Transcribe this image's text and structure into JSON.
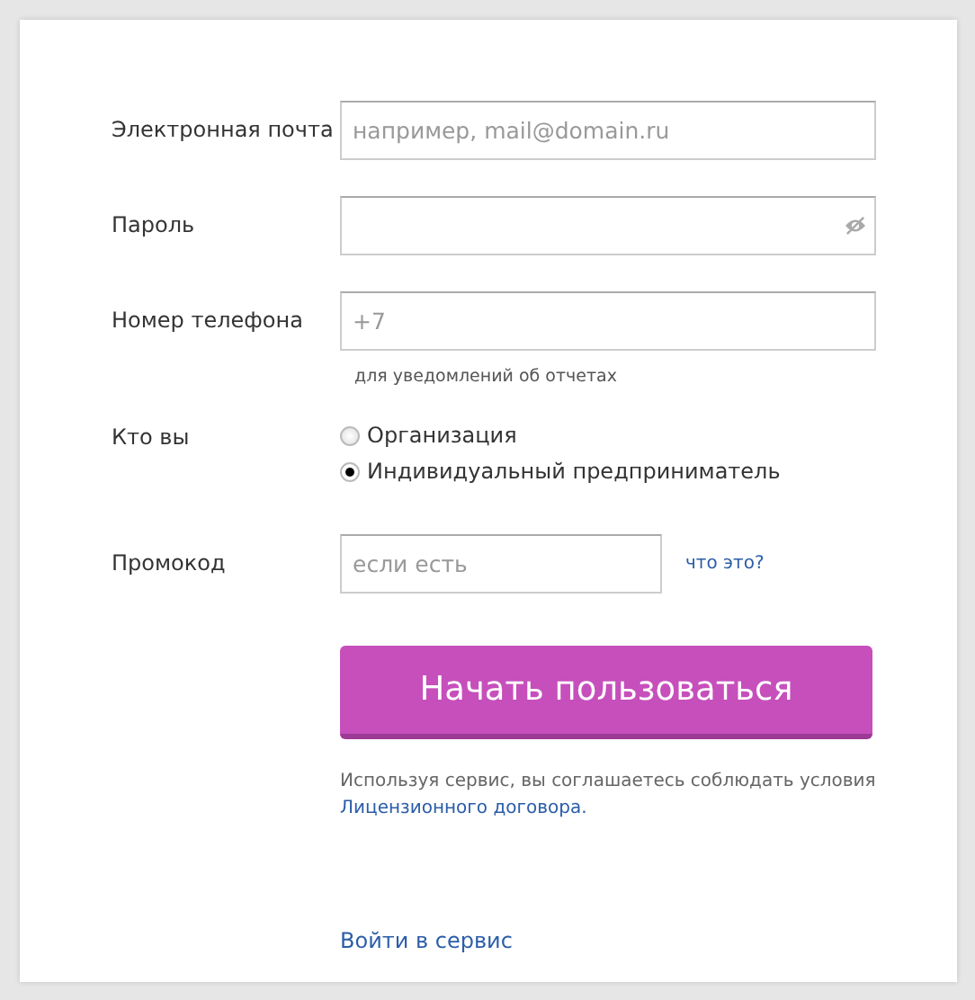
{
  "fields": [
    {
      "kind": "text",
      "label": "Электронная почта",
      "placeholder": "например, mail@domain.ru"
    },
    {
      "kind": "password",
      "label": "Пароль"
    },
    {
      "kind": "text",
      "label": "Номер телефона",
      "placeholder": "+7",
      "hint": "для уведомлений об отчетах"
    }
  ],
  "role": {
    "label": "Кто вы",
    "options": [
      {
        "label": "Организация",
        "selected": false
      },
      {
        "label": "Индивидуальный предприниматель",
        "selected": true
      }
    ]
  },
  "promo": {
    "label": "Промокод",
    "placeholder": "если есть",
    "link": "что это?"
  },
  "submit": "Начать пользоваться",
  "agreement": {
    "text": "Используя сервис, вы соглашаетесь соблюдать условия",
    "link": "Лицензионного договора."
  },
  "login_link": "Войти в сервис"
}
